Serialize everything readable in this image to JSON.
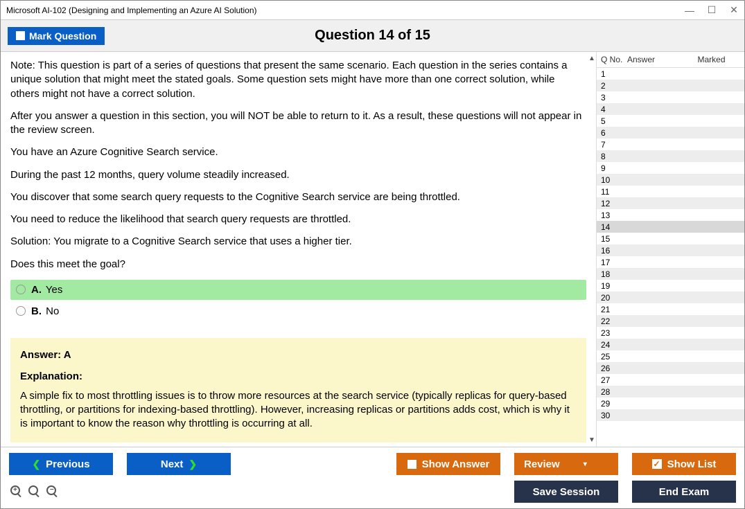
{
  "window_title": "Microsoft AI-102 (Designing and Implementing an Azure AI Solution)",
  "header": {
    "mark_label": "Mark Question",
    "question_counter": "Question 14 of 15"
  },
  "question": {
    "p1": "Note: This question is part of a series of questions that present the same scenario. Each question in the series contains a unique solution that might meet the stated goals. Some question sets might have more than one correct solution, while others might not have a correct solution.",
    "p2": "After you answer a question in this section, you will NOT be able to return to it. As a result, these questions will not appear in the review screen.",
    "p3": "You have an Azure Cognitive Search service.",
    "p4": "During the past 12 months, query volume steadily increased.",
    "p5": "You discover that some search query requests to the Cognitive Search service are being throttled.",
    "p6": "You need to reduce the likelihood that search query requests are throttled.",
    "p7": "Solution: You migrate to a Cognitive Search service that uses a higher tier.",
    "p8": "Does this meet the goal?"
  },
  "options": {
    "a_letter": "A.",
    "a_text": "Yes",
    "b_letter": "B.",
    "b_text": "No"
  },
  "explanation": {
    "answer_line": "Answer: A",
    "label": "Explanation:",
    "text": "A simple fix to most throttling issues is to throw more resources at the search service (typically replicas for query-based throttling, or partitions for indexing-based throttling). However, increasing replicas or partitions adds cost, which is why it is important to know the reason why throttling is occurring at all."
  },
  "sidebar": {
    "col_qno": "Q No.",
    "col_answer": "Answer",
    "col_marked": "Marked",
    "current": 14,
    "rows": [
      1,
      2,
      3,
      4,
      5,
      6,
      7,
      8,
      9,
      10,
      11,
      12,
      13,
      14,
      15,
      16,
      17,
      18,
      19,
      20,
      21,
      22,
      23,
      24,
      25,
      26,
      27,
      28,
      29,
      30
    ]
  },
  "footer": {
    "previous": "Previous",
    "next": "Next",
    "show_answer": "Show Answer",
    "review": "Review",
    "show_list": "Show List",
    "save_session": "Save Session",
    "end_exam": "End Exam"
  }
}
